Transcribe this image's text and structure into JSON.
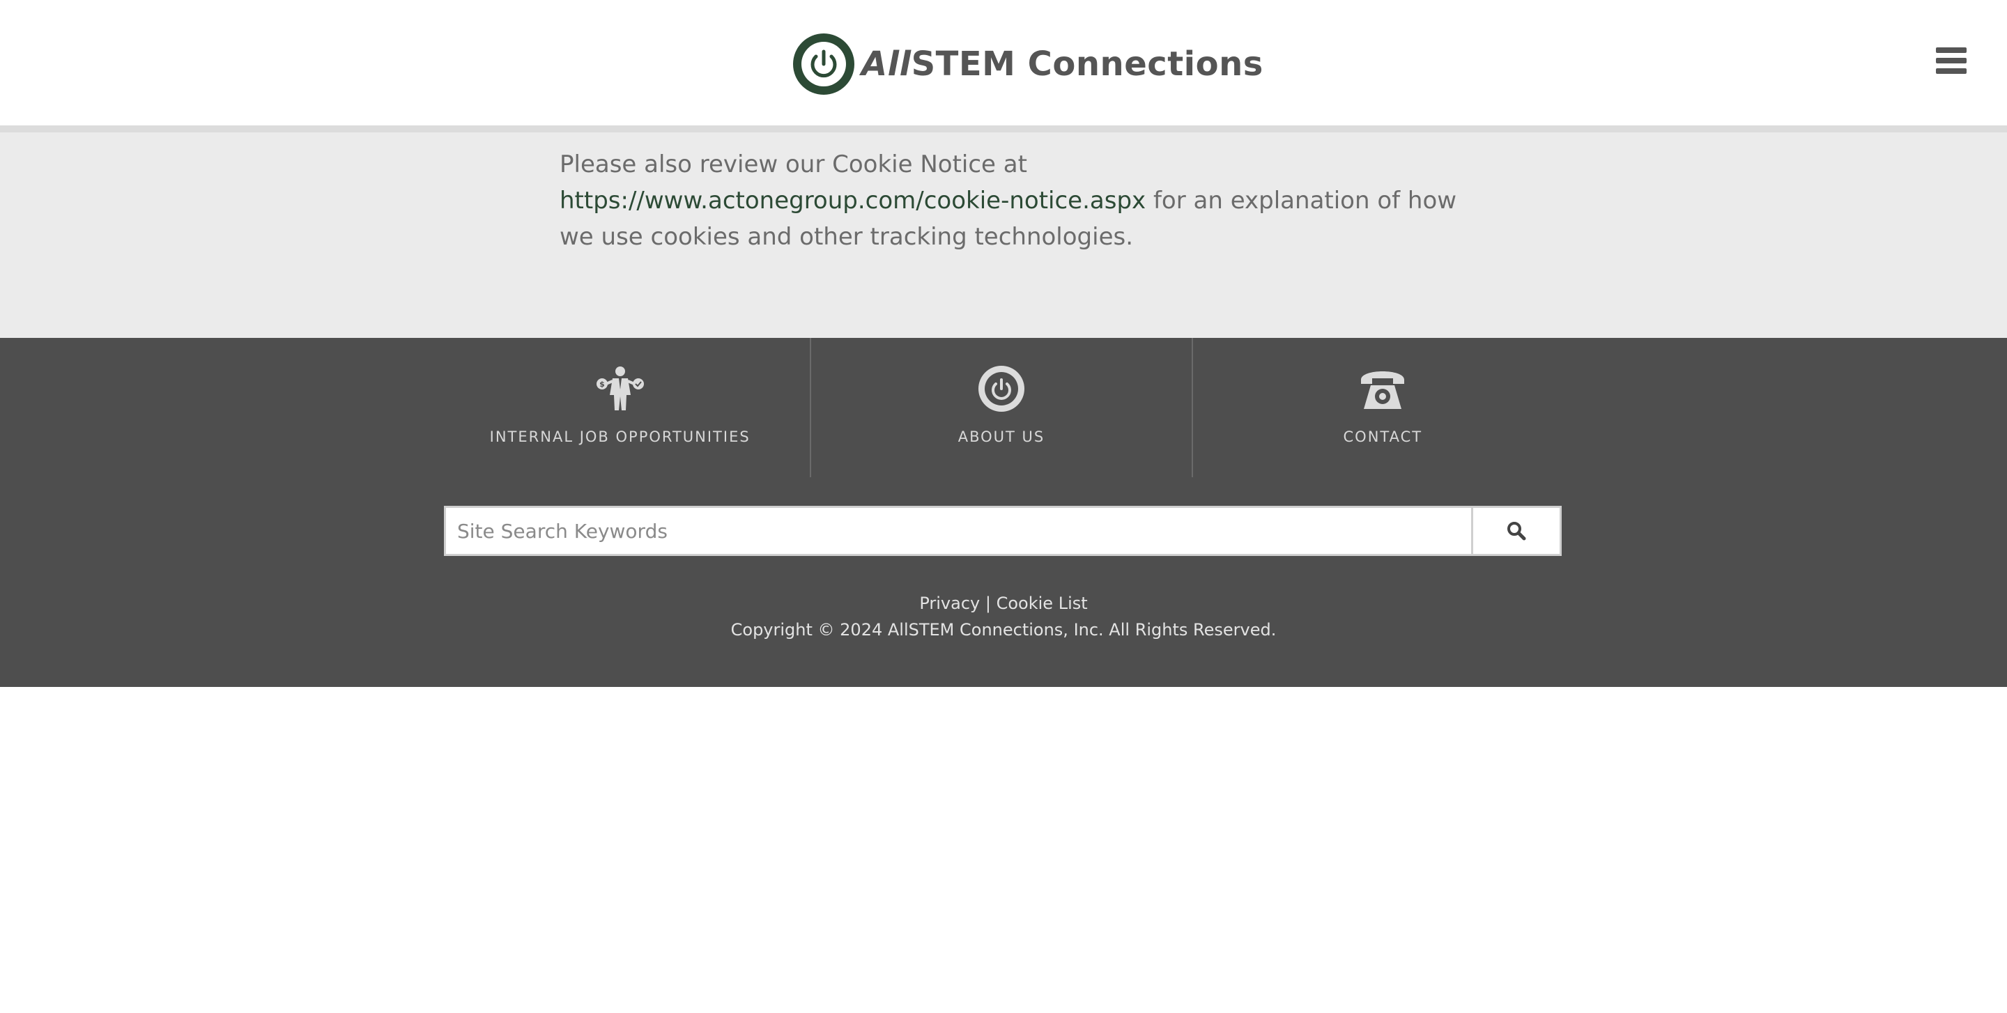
{
  "header": {
    "brand_prefix": "All",
    "brand_name": "STEM Connections",
    "logo_icon": "power-icon",
    "menu_icon": "hamburger-menu-icon"
  },
  "notice": {
    "text_before": "Please also review our Cookie Notice at ",
    "link_text": "https://www.actonegroup.com/cookie-notice.aspx",
    "text_after": " for an explanation of how we use cookies and other tracking technologies."
  },
  "footer_nav": [
    {
      "label": "INTERNAL JOB OPPORTUNITIES",
      "icon": "businessman-icon"
    },
    {
      "label": "ABOUT US",
      "icon": "power-icon"
    },
    {
      "label": "CONTACT",
      "icon": "telephone-icon"
    }
  ],
  "search": {
    "placeholder": "Site Search Keywords",
    "value": "",
    "button_icon": "search-icon"
  },
  "legal": {
    "privacy": "Privacy",
    "separator": "|",
    "cookie_list": "Cookie List",
    "copyright": "Copyright © 2024 AllSTEM Connections, Inc. All Rights Reserved."
  },
  "colors": {
    "brand_green": "#2c4a35",
    "footer_bg": "#4e4e4e",
    "notice_bg": "#ebebeb"
  }
}
